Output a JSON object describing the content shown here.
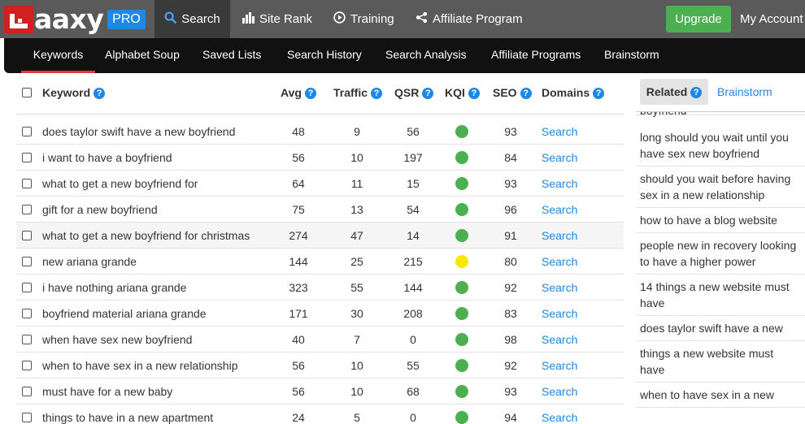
{
  "app": {
    "logo_text": "aaxy",
    "pro_badge": "PRO",
    "nav": [
      {
        "label": "Search",
        "icon": "search-icon",
        "active": true
      },
      {
        "label": "Site Rank",
        "icon": "bar-chart-icon"
      },
      {
        "label": "Training",
        "icon": "play-circle-icon"
      },
      {
        "label": "Affiliate Program",
        "icon": "share-icon"
      }
    ],
    "upgrade_label": "Upgrade",
    "account_label": "My Account"
  },
  "subnav": [
    {
      "label": "Keywords",
      "active": true
    },
    {
      "label": "Alphabet Soup"
    },
    {
      "label": "Saved Lists"
    },
    {
      "label": "Search History"
    },
    {
      "label": "Search Analysis"
    },
    {
      "label": "Affiliate Programs"
    },
    {
      "label": "Brainstorm"
    }
  ],
  "table": {
    "headers": {
      "keyword": "Keyword",
      "avg": "Avg",
      "traffic": "Traffic",
      "qsr": "QSR",
      "kqi": "KQI",
      "seo": "SEO",
      "domains": "Domains"
    },
    "rows": [
      {
        "keyword": "does taylor swift have a new boyfriend",
        "avg": "48",
        "traffic": "9",
        "qsr": "56",
        "kqi": "green",
        "seo": "93",
        "domains": "Search"
      },
      {
        "keyword": "i want to have a boyfriend",
        "avg": "56",
        "traffic": "10",
        "qsr": "197",
        "kqi": "green",
        "seo": "84",
        "domains": "Search"
      },
      {
        "keyword": "what to get a new boyfriend for",
        "avg": "64",
        "traffic": "11",
        "qsr": "15",
        "kqi": "green",
        "seo": "93",
        "domains": "Search"
      },
      {
        "keyword": "gift for a new boyfriend",
        "avg": "75",
        "traffic": "13",
        "qsr": "54",
        "kqi": "green",
        "seo": "96",
        "domains": "Search"
      },
      {
        "keyword": "what to get a new boyfriend for christmas",
        "avg": "274",
        "traffic": "47",
        "qsr": "14",
        "kqi": "green",
        "seo": "91",
        "domains": "Search",
        "highlight": true
      },
      {
        "keyword": "new ariana grande",
        "avg": "144",
        "traffic": "25",
        "qsr": "215",
        "kqi": "yellow",
        "seo": "80",
        "domains": "Search"
      },
      {
        "keyword": "i have nothing ariana grande",
        "avg": "323",
        "traffic": "55",
        "qsr": "144",
        "kqi": "green",
        "seo": "92",
        "domains": "Search"
      },
      {
        "keyword": "boyfriend material ariana grande",
        "avg": "171",
        "traffic": "30",
        "qsr": "208",
        "kqi": "green",
        "seo": "83",
        "domains": "Search"
      },
      {
        "keyword": "when have sex new boyfriend",
        "avg": "40",
        "traffic": "7",
        "qsr": "0",
        "kqi": "green",
        "seo": "98",
        "domains": "Search"
      },
      {
        "keyword": "when to have sex in a new relationship",
        "avg": "56",
        "traffic": "10",
        "qsr": "55",
        "kqi": "green",
        "seo": "92",
        "domains": "Search"
      },
      {
        "keyword": "must have for a new baby",
        "avg": "56",
        "traffic": "10",
        "qsr": "68",
        "kqi": "green",
        "seo": "93",
        "domains": "Search"
      },
      {
        "keyword": "things to have in a new apartment",
        "avg": "24",
        "traffic": "5",
        "qsr": "0",
        "kqi": "green",
        "seo": "94",
        "domains": "Search"
      }
    ]
  },
  "related": {
    "tab_related": "Related",
    "tab_brainstorm": "Brainstorm",
    "items": [
      "boyfriend",
      "long should you wait until you have sex new boyfriend",
      "should you wait before having sex in a new relationship",
      "how to have a blog website",
      "people new in recovery looking to have a higher power",
      "14 things a new website must have",
      "does taylor swift have a new",
      "things a new website must have",
      "when to have sex in a new"
    ]
  },
  "colors": {
    "kqi_green": "#4caf50",
    "kqi_yellow": "#f5e800",
    "accent": "#1e88e5",
    "active_tab_underline": "#e53935"
  }
}
